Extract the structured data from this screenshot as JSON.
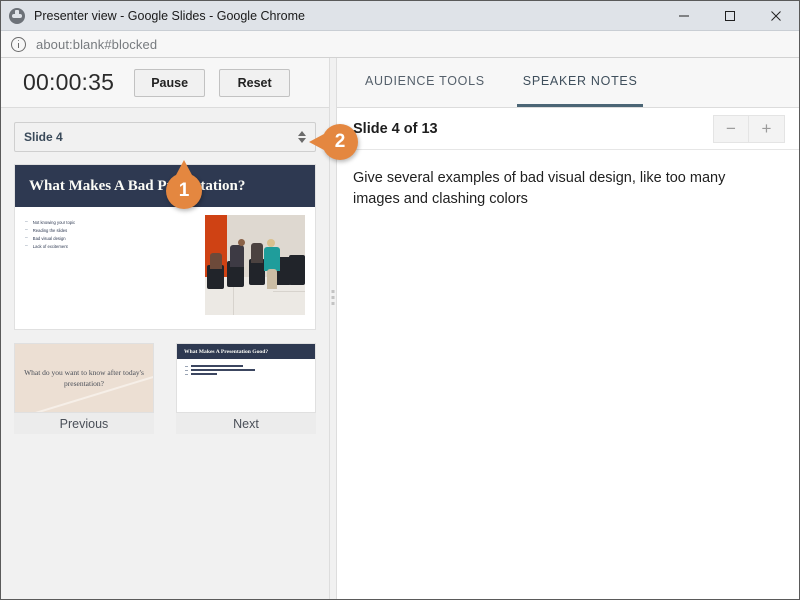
{
  "window": {
    "title": "Presenter view - Google Slides - Google Chrome",
    "favicon": "globe-icon",
    "minimize_label": "Minimize",
    "maximize_label": "Maximize",
    "close_label": "Close"
  },
  "address_bar": {
    "info_icon": "info-circle-icon",
    "url": "about:blank#blocked"
  },
  "timer_bar": {
    "time": "00:00:35",
    "pause_label": "Pause",
    "reset_label": "Reset"
  },
  "slide_selector": {
    "value": "Slide 4",
    "spinner_icon": "spinner-up-down-icon"
  },
  "current_slide": {
    "title": "What Makes A Bad Presentation?",
    "bullets": [
      "Not knowing your topic",
      "Reading the slides",
      "Bad visual design",
      "Lack of excitement"
    ],
    "image_alt": "audience-photo"
  },
  "previous_slide": {
    "text": "What do you want to know after today's presentation?",
    "label": "Previous"
  },
  "next_slide": {
    "title": "What Makes A Presentation Good?",
    "label": "Next"
  },
  "splitter": {
    "grip_icon": "drag-handle-icon"
  },
  "tabs": [
    {
      "label": "AUDIENCE TOOLS",
      "active": false
    },
    {
      "label": "SPEAKER NOTES",
      "active": true
    }
  ],
  "notes": {
    "heading": "Slide 4 of 13",
    "decrease_label": "−",
    "increase_label": "+",
    "text": "Give several examples of bad visual design, like too many images and clashing colors"
  },
  "callouts": [
    {
      "number": "1",
      "points_to": "pause-button"
    },
    {
      "number": "2",
      "points_to": "reset-button"
    }
  ],
  "colors": {
    "accent_orange": "#e48740",
    "slide_navy": "#2e3951",
    "tab_underline": "#4b6575",
    "panel_gray": "#f1f1f1"
  }
}
